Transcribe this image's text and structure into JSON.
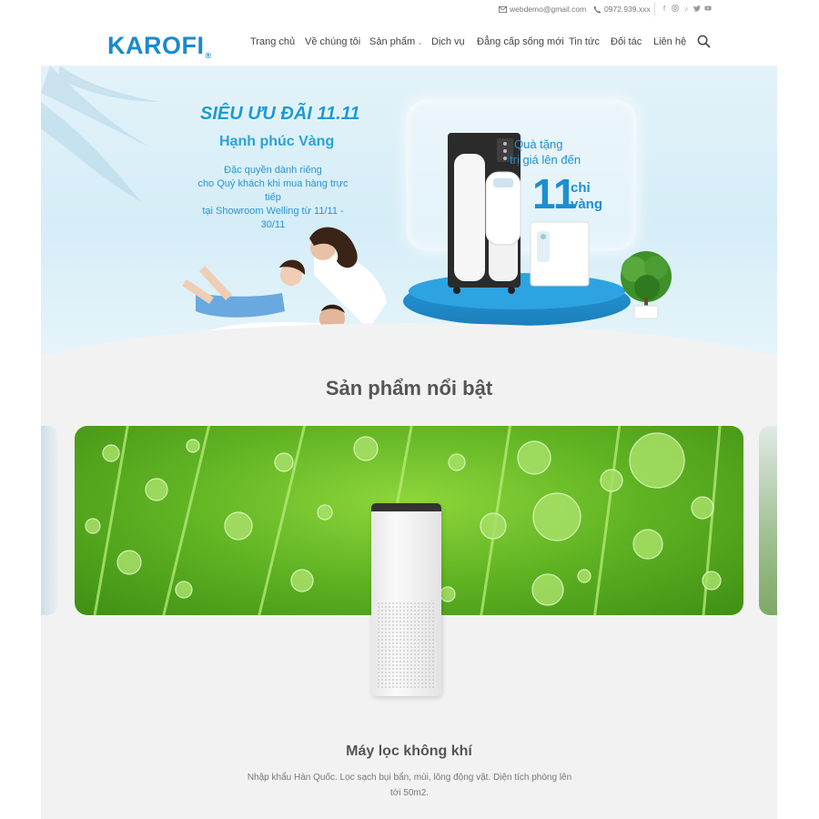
{
  "topbar": {
    "email": "webdemo@gmail.com",
    "phone": "0972.939.xxx",
    "social_icons": [
      "facebook-icon",
      "instagram-icon",
      "tiktok-icon",
      "twitter-icon",
      "youtube-icon"
    ]
  },
  "header": {
    "logo_text": "KAROFI",
    "logo_mark": "®",
    "nav": [
      {
        "label": "Trang chủ"
      },
      {
        "label": "Về chúng tôi"
      },
      {
        "label": "Sản phẩm",
        "has_dropdown": true
      },
      {
        "label": "Dịch vụ"
      },
      {
        "label": "Đẳng cấp sống mới"
      },
      {
        "label": "Tin tức"
      },
      {
        "label": "Đối tác"
      },
      {
        "label": "Liên hệ"
      }
    ]
  },
  "hero": {
    "headline": "SIÊU ƯU ĐÃI 11.11",
    "subheadline": "Hạnh phúc Vàng",
    "description_lines": [
      "Đặc quyền dành riêng",
      "cho Quý khách khi mua hàng trực tiếp",
      "tại Showroom Welling từ 11/11 - 30/11"
    ],
    "gift_line1": "Quà tặng",
    "gift_line2": "trị giá lên đến",
    "gift_number": "11",
    "gift_unit_line1": "chỉ",
    "gift_unit_line2": "vàng"
  },
  "featured": {
    "title": "Sản phẩm nổi bật",
    "product_title": "Máy lọc không khí",
    "product_desc": "Nhập khẩu Hàn Quốc. Lọc sạch bụi bẩn, mùi, lông động vật. Diện tích phòng lên tới 50m2."
  },
  "colors": {
    "brand_blue": "#1a8ad0",
    "section_bg": "#f2f2f2",
    "leaf_green": "#5fb322"
  }
}
